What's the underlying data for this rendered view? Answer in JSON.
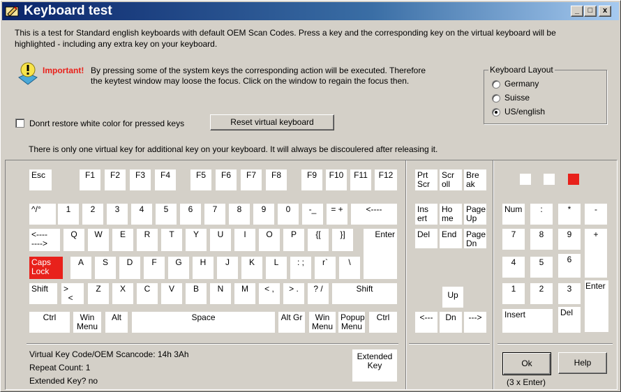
{
  "window": {
    "title": "Keyboard test",
    "minimize": "_",
    "maximize": "□",
    "close": "x"
  },
  "intro": "This is a test for Standard english keyboards with default OEM Scan Codes. Press a key and the corresponding key on the virtual keyboard will be",
  "intro2": "highlighted - including any extra key on your keyboard.",
  "important_label": "Important!",
  "important_text1": "By pressing some of the system keys the corresponding action will be executed. Therefore",
  "important_text2": "the keytest window may loose the focus. Click on the window to regain the focus then.",
  "layout_group": {
    "label": "Keyboard Layout",
    "options": [
      "Germany",
      "Suisse",
      "US/english"
    ],
    "selected": "US/english"
  },
  "dont_restore_label": "Donrt restore white color for pressed keys",
  "reset_button": "Reset virtual keyboard",
  "info_line": "There is only one virtual key for additional key on your keyboard. It will always be discoulered after releasing it.",
  "colors": {
    "pressed": "#e8211b",
    "key": "#ffffff",
    "title_start": "#0a246a"
  },
  "keys": {
    "esc": "Esc",
    "f1": "F1",
    "f2": "F2",
    "f3": "F3",
    "f4": "F4",
    "f5": "F5",
    "f6": "F6",
    "f7": "F7",
    "f8": "F8",
    "f9": "F9",
    "f10": "F10",
    "f11": "F11",
    "f12": "F12",
    "prtscr": "Prt\nScr",
    "scroll": "Scr\noll",
    "break": "Bre\nak",
    "caret": "^/°",
    "k1": "1",
    "k2": "2",
    "k3": "3",
    "k4": "4",
    "k5": "5",
    "k6": "6",
    "k7": "7",
    "k8": "8",
    "k9": "9",
    "k0": "0",
    "minus": "-_",
    "equal": "= +",
    "back": "<----",
    "insert": "Ins\nert",
    "home": "Ho\nme",
    "pageup": "Page\nUp",
    "numlock": "Num",
    "numdiv": ":",
    "nummul": "*",
    "numsub": "-",
    "tab": "<----\n---->",
    "q": "Q",
    "w": "W",
    "e": "E",
    "r": "R",
    "t": "T",
    "y": "Y",
    "u": "U",
    "i": "I",
    "o": "O",
    "p": "P",
    "lbr": "{[",
    "rbr": "}]",
    "enter": "Enter",
    "del": "Del",
    "end": "End",
    "pagedn": "Page\nDn",
    "n7": "7",
    "n8": "8",
    "n9": "9",
    "nadd": "+",
    "caps": "Caps\nLock",
    "a": "A",
    "s": "S",
    "d": "D",
    "f": "F",
    "g": "G",
    "h": "H",
    "j": "J",
    "k": "K",
    "l": "L",
    "semi": ": ;",
    "quote": "r`",
    "bslash": "\\",
    "n4": "4",
    "n5": "5",
    "n6": "6",
    "lshift": "Shift",
    "ltgt": ">\n  <",
    "z": "Z",
    "x": "X",
    "c": "C",
    "v": "V",
    "b": "B",
    "n": "N",
    "m": "M",
    "comma": "< ,",
    "period": "> .",
    "slash": "? /",
    "rshift": "Shift",
    "up": "Up",
    "n1": "1",
    "n2": "2",
    "n3": "3",
    "nenter": "Enter",
    "lctrl": "Ctrl",
    "lwin": "Win\nMenu",
    "alt": "Alt",
    "space": "Space",
    "altgr": "Alt Gr",
    "rwin": "Win\nMenu",
    "popup": "Popup\nMenu",
    "rctrl": "Ctrl",
    "left": "<---",
    "down": "Dn",
    "right": "--->",
    "ninsert": "Insert",
    "ndel": "Del"
  },
  "status": {
    "vk": "Virtual Key Code/OEM Scancode: 14h 3Ah",
    "repeat": "Repeat Count: 1",
    "extended": "Extended Key? no"
  },
  "extended_key": "Extended\nKey",
  "ok_button": "Ok",
  "help_button": "Help",
  "ok_hint": "(3 x Enter)"
}
